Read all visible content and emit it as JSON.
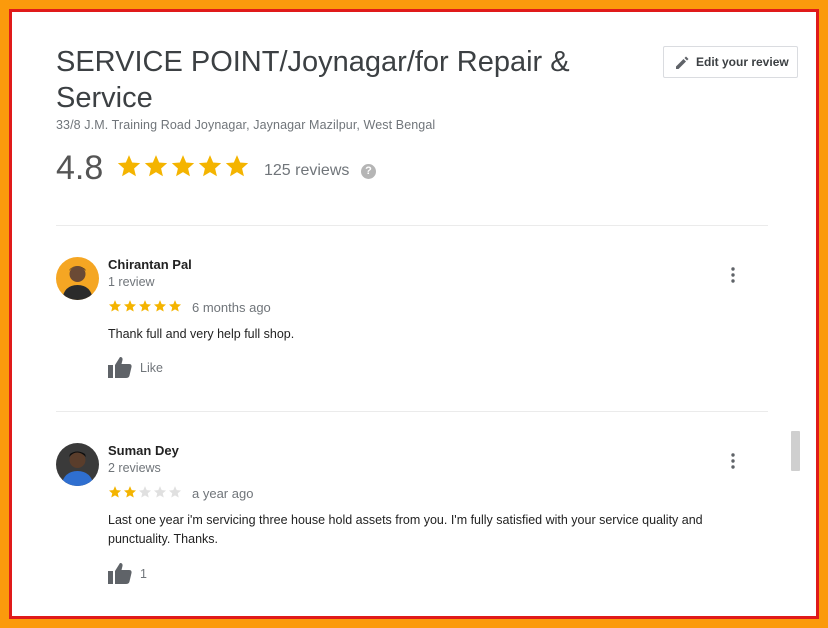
{
  "place": {
    "title": "SERVICE POINT/Joynagar/for Repair & Service",
    "address": "33/8 J.M. Training Road Joynagar, Jaynagar Mazilpur, West Bengal",
    "rating": "4.8",
    "rating_stars": 5,
    "review_count_label": "125 reviews",
    "help_icon": "?"
  },
  "header": {
    "edit_review_label": "Edit your review"
  },
  "reviews": [
    {
      "author": "Chirantan Pal",
      "author_sub": "1 review",
      "stars": 5,
      "date": "6 months ago",
      "text": "Thank full and very help full shop.",
      "like_label": "Like"
    },
    {
      "author": "Suman Dey",
      "author_sub": "2 reviews",
      "stars": 2,
      "date": "a year ago",
      "text": "Last one year i'm servicing three house hold assets from you. I'm fully satisfied with your service quality and punctuality. Thanks.",
      "like_label": "1"
    }
  ],
  "colors": {
    "star_filled": "#f4b400",
    "star_empty": "#e0e0e0",
    "frame_orange": "#fb9a0c",
    "frame_red": "#e01a1a"
  }
}
